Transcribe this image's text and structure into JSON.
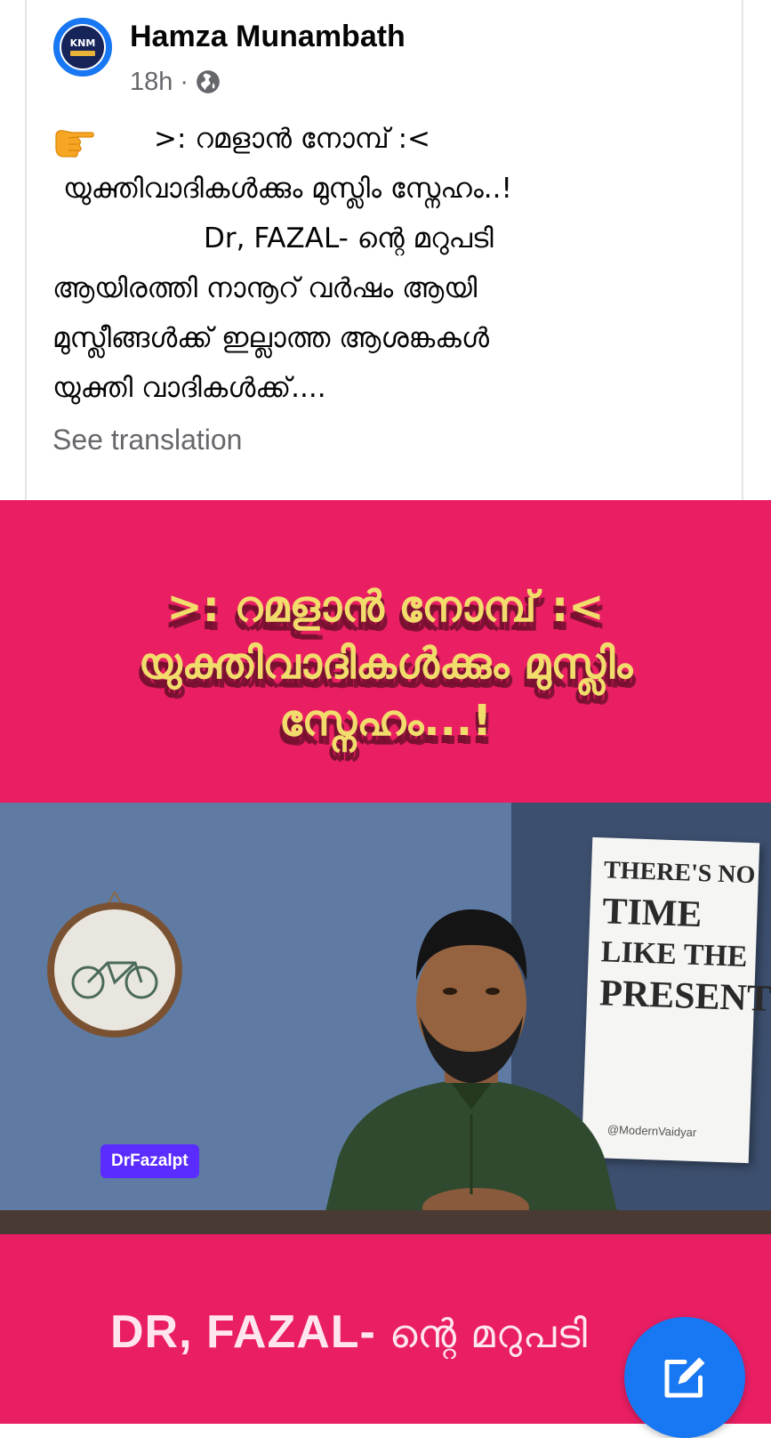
{
  "post": {
    "author": "Hamza Munambath",
    "avatar_text": "KNM",
    "timestamp": "18h",
    "separator": "·",
    "audience_icon": "globe-icon",
    "emoji": "👉",
    "lines": [
      ">: റമളാൻ നോമ്പ് :<",
      "യുക്തിവാദികൾക്കും മുസ്ലിം സ്നേഹം..!",
      "Dr, FAZAL- ന്റെ മറുപടി",
      "ആയിരത്തി നാനൂറ് വർഷം ആയി",
      "മുസ്ലീങ്ങൾക്ക് ഇല്ലാത്ത ആശങ്കകൾ",
      "യുക്തി വാദികൾക്ക്...."
    ],
    "see_translation": "See translation"
  },
  "media": {
    "headline_lines": [
      ">: റമളാൻ നോമ്പ് :<",
      "യുക്തിവാദികൾക്കും മുസ്ലിം",
      "സ്നേഹം...!"
    ],
    "poster_lines": [
      "THERE'S NO",
      "TIME",
      "LIKE THE",
      "PRESENT"
    ],
    "poster_handle": "@ModernVaidyar",
    "channel_badge": "DrFazalpt",
    "caption_latin": "DR, FAZAL-",
    "caption_ml": " ന്റെ മറുപടി",
    "background_color": "#e91e63"
  },
  "fab": {
    "icon": "edit-icon",
    "color": "#1877f2"
  }
}
